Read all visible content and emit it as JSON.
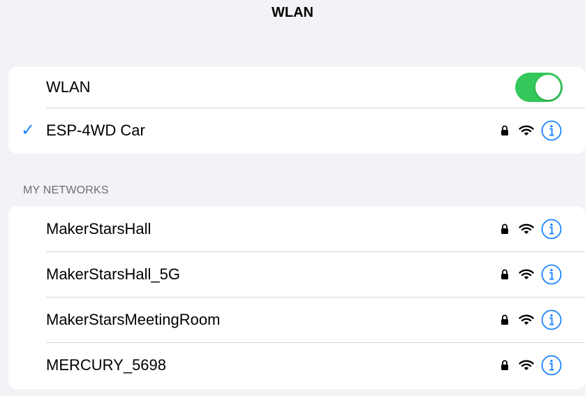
{
  "page": {
    "title": "WLAN"
  },
  "wlan_group": {
    "toggle": {
      "label": "WLAN",
      "enabled": true,
      "on_color": "#34c759"
    },
    "connected": {
      "check": "✓",
      "ssid": "ESP-4WD Car",
      "secured": true,
      "icons": [
        "lock-icon",
        "wifi-icon",
        "info-icon"
      ]
    }
  },
  "my_networks": {
    "header": "MY NETWORKS",
    "items": [
      {
        "ssid": "MakerStarsHall",
        "secured": true
      },
      {
        "ssid": "MakerStarsHall_5G",
        "secured": true
      },
      {
        "ssid": "MakerStarsMeetingRoom",
        "secured": true
      },
      {
        "ssid": "MERCURY_5698",
        "secured": true
      }
    ]
  },
  "colors": {
    "accent": "#1a84ff",
    "background": "#f2f2f7",
    "header_text": "#6d6d72"
  }
}
